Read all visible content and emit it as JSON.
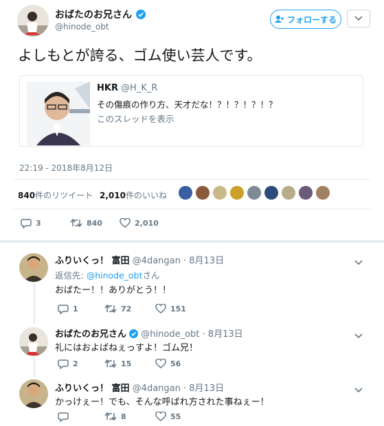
{
  "tweet": {
    "author_name": "おばたのお兄さん",
    "author_handle": "@hinode_obt",
    "follow_label": "フォローする",
    "text": "よしもとが誇る、ゴム使い芸人です。",
    "quote": {
      "name": "HKR",
      "handle": "@H_K_R",
      "text": "その傷痕の作り方、天才だな！？！？！？！？",
      "link": "このスレッドを表示"
    },
    "timestamp": "22:19 - 2018年8月12日",
    "retweets_count": "840",
    "retweets_label": "件のリツイート",
    "likes_count": "2,010",
    "likes_label": "件のいいね",
    "actions": {
      "replies": "3",
      "retweets": "840",
      "likes": "2,010"
    }
  },
  "replies": [
    {
      "name": "ふりいくっ！ 富田",
      "handle": "@4dangan",
      "date": "· 8月13日",
      "reply_to_prefix": "返信先: ",
      "reply_to_handle": "@hinode_obt",
      "reply_to_suffix": "さん",
      "text": "おばたー！！ありがとう！！",
      "replies": "1",
      "retweets": "72",
      "likes": "151"
    },
    {
      "name": "おばたのお兄さん",
      "handle": "@hinode_obt",
      "date": "· 8月13日",
      "text": "礼にはおよばねぇっすよ！ゴム兄！",
      "replies": "2",
      "retweets": "15",
      "likes": "56"
    },
    {
      "name": "ふりいくっ！ 富田",
      "handle": "@4dangan",
      "date": "· 8月13日",
      "text": "かっけぇー！でも、そんな呼ばれ方された事ねぇー！",
      "replies": "",
      "retweets": "8",
      "likes": "55"
    }
  ],
  "colors": {
    "accent": "#1da1f2",
    "gray": "#657786",
    "verified": "#1da1f2"
  },
  "icons": [
    "verified-badge-icon",
    "chevron-down-icon",
    "reply-icon",
    "retweet-icon",
    "heart-icon"
  ]
}
